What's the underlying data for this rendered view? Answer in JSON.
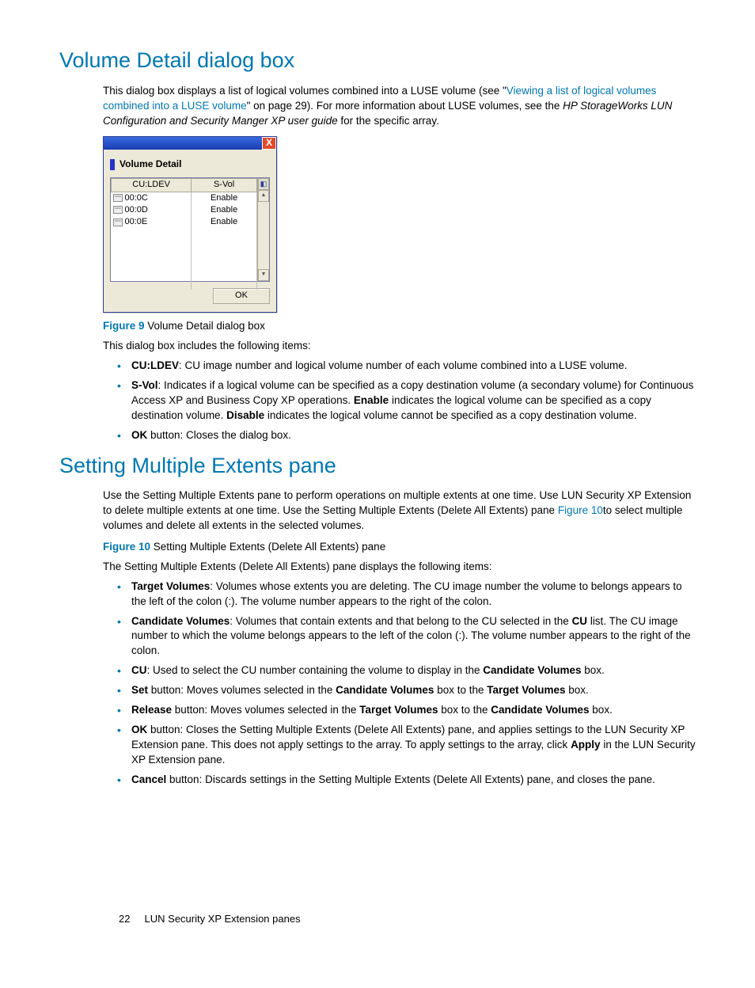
{
  "heading1": "Volume Detail dialog box",
  "intro": {
    "pre": "This dialog box displays a list of logical volumes combined into a LUSE volume (see \"",
    "link": "Viewing a list of logical volumes combined into a LUSE volume",
    "post1": "\" on page 29). For more information about LUSE volumes, see the ",
    "italic": "HP StorageWorks LUN Configuration and Security Manger XP user guide",
    "post2": " for the specific array."
  },
  "dialog": {
    "title": "Volume Detail",
    "close": "X",
    "cols": {
      "c1": "CU:LDEV",
      "c2": "S-Vol"
    },
    "rows": [
      {
        "ldev": "00:0C",
        "svol": "Enable"
      },
      {
        "ldev": "00:0D",
        "svol": "Enable"
      },
      {
        "ldev": "00:0E",
        "svol": "Enable"
      }
    ],
    "ok": "OK"
  },
  "fig9": {
    "label": "Figure 9",
    "caption": "Volume Detail dialog box"
  },
  "p_items": "This dialog box includes the following items:",
  "list1": {
    "i1": {
      "b": "CU:LDEV",
      "t": ": CU image number and logical volume number of each volume combined into a LUSE volume."
    },
    "i2": {
      "b": "S-Vol",
      "t1": ": Indicates if a logical volume can be specified as a copy destination volume (a secondary volume) for Continuous Access XP and Business Copy XP operations. ",
      "b2": "Enable",
      "t2": " indicates the logical volume can be specified as a copy destination volume. ",
      "b3": "Disable",
      "t3": " indicates the logical volume cannot be specified as a copy destination volume."
    },
    "i3": {
      "b": "OK",
      "t": " button: Closes the dialog box."
    }
  },
  "heading2": "Setting Multiple Extents pane",
  "p_sme": {
    "t1": "Use the Setting Multiple Extents pane to perform operations on multiple extents at one time. Use LUN Security XP Extension to delete multiple extents at one time. Use the Setting Multiple Extents (Delete All Extents) pane ",
    "link": "Figure 10",
    "t2": "to select multiple volumes and delete all extents in the selected volumes."
  },
  "fig10": {
    "label": "Figure 10",
    "caption": "Setting Multiple Extents (Delete All Extents) pane"
  },
  "p_sme_items": "The Setting Multiple Extents (Delete All Extents) pane displays the following items:",
  "list2": {
    "i1": {
      "b": "Target Volumes",
      "t": ": Volumes whose extents you are deleting. The CU image number the volume to belongs appears to the left of the colon (:). The volume number appears to the right of the colon."
    },
    "i2": {
      "b": "Candidate Volumes",
      "t1": ": Volumes that contain extents and that belong to the CU selected in the ",
      "b2": "CU",
      "t2": " list. The CU image number to which the volume belongs appears to the left of the colon (:). The volume number appears to the right of the colon."
    },
    "i3": {
      "b": "CU",
      "t1": ": Used to select the CU number containing the volume to display in the ",
      "b2": "Candidate Volumes",
      "t2": " box."
    },
    "i4": {
      "b": "Set",
      "t1": " button: Moves volumes selected in the ",
      "b2": "Candidate Volumes",
      "t2": " box to the ",
      "b3": "Target Volumes",
      "t3": " box."
    },
    "i5": {
      "b": "Release",
      "t1": " button: Moves volumes selected in the ",
      "b2": "Target Volumes",
      "t2": " box to the ",
      "b3": "Candidate Volumes",
      "t3": " box."
    },
    "i6": {
      "b": "OK",
      "t1": " button: Closes the Setting Multiple Extents (Delete All Extents) pane, and applies settings to the LUN Security XP Extension pane. This does not apply settings to the array. To apply settings to the array, click ",
      "b2": "Apply",
      "t2": " in the LUN Security XP Extension pane."
    },
    "i7": {
      "b": "Cancel",
      "t": " button: Discards settings in the Setting Multiple Extents (Delete All Extents) pane, and closes the pane."
    }
  },
  "footer": {
    "page": "22",
    "title": "LUN Security XP Extension panes"
  }
}
